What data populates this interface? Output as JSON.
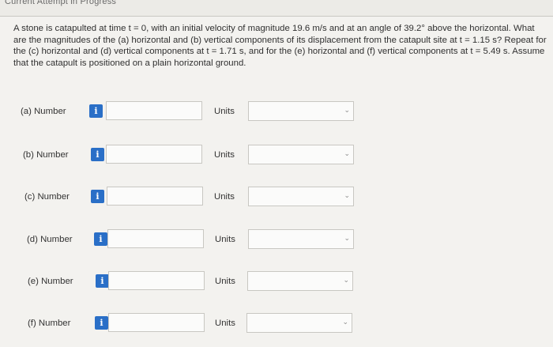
{
  "header": {
    "title": "Current Attempt in Progress"
  },
  "question": {
    "text": "A stone is catapulted at time t = 0, with an initial velocity of magnitude 19.6 m/s and at an angle of 39.2° above the horizontal. What are the magnitudes of the (a) horizontal and (b) vertical components of its displacement from the catapult site at t = 1.15 s? Repeat for the (c) horizontal and (d) vertical components at t = 1.71 s, and for the (e) horizontal and (f) vertical components at t = 5.49 s. Assume that the catapult is positioned on a plain horizontal ground."
  },
  "icons": {
    "info": "info-icon",
    "dropdown": "chevron-down-icon"
  },
  "colors": {
    "info_badge": "#2a6fc7"
  },
  "rows": [
    {
      "label": "(a)   Number",
      "info_glyph": "i",
      "value": "",
      "units_label": "Units",
      "unit_value": "",
      "chevron": "⌄"
    },
    {
      "label": "(b)   Number",
      "info_glyph": "i",
      "value": "",
      "units_label": "Units",
      "unit_value": "",
      "chevron": "⌄"
    },
    {
      "label": "(c)   Number",
      "info_glyph": "i",
      "value": "",
      "units_label": "Units",
      "unit_value": "",
      "chevron": "⌄"
    },
    {
      "label": "(d)   Number",
      "info_glyph": "i",
      "value": "",
      "units_label": "Units",
      "unit_value": "",
      "chevron": "⌄"
    },
    {
      "label": "(e)   Number",
      "info_glyph": "i",
      "value": "",
      "units_label": "Units",
      "unit_value": "",
      "chevron": "⌄"
    },
    {
      "label": "(f)   Number",
      "info_glyph": "i",
      "value": "",
      "units_label": "Units",
      "unit_value": "",
      "chevron": "⌄"
    }
  ]
}
